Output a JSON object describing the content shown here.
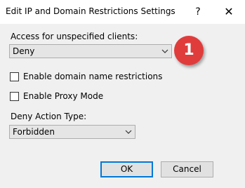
{
  "window": {
    "title": "Edit IP and Domain Restrictions Settings",
    "help_glyph": "?",
    "close_glyph": "✕"
  },
  "access": {
    "label": "Access for unspecified clients:",
    "selected": "Deny"
  },
  "annotation": {
    "label": "1",
    "color": "#e03c3c"
  },
  "options": {
    "domain_restrictions": {
      "label": "Enable domain name restrictions",
      "checked": false
    },
    "proxy_mode": {
      "label": "Enable Proxy Mode",
      "checked": false
    }
  },
  "deny_action": {
    "label": "Deny Action Type:",
    "selected": "Forbidden"
  },
  "buttons": {
    "ok": "OK",
    "cancel": "Cancel"
  },
  "colors": {
    "accent": "#0078d7",
    "background": "#f0f0f0"
  }
}
